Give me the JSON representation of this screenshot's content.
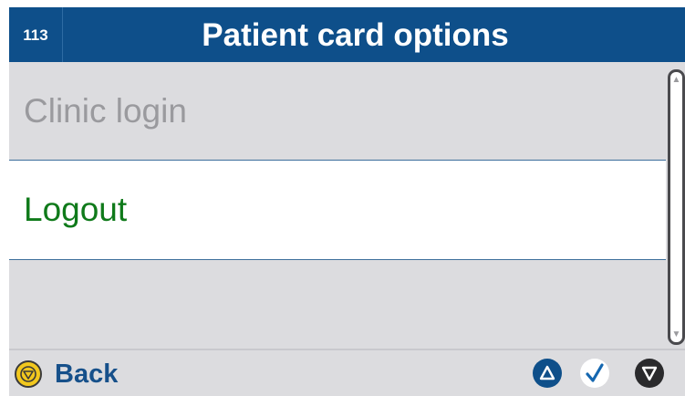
{
  "header": {
    "screen_number": "113",
    "title": "Patient card options"
  },
  "menu": {
    "items": [
      {
        "label": "Clinic login",
        "state": "disabled"
      },
      {
        "label": "Logout",
        "state": "selected"
      }
    ]
  },
  "scrollbar": {
    "up_icon": "triangle-up",
    "down_icon": "triangle-down"
  },
  "footer": {
    "back_label": "Back",
    "back_icon": "stop-icon",
    "nav_icons": [
      "up-icon",
      "confirm-check-icon",
      "down-icon"
    ]
  },
  "colors": {
    "header_bg": "#0e4f8a",
    "selected_text": "#0f7a1a",
    "disabled_text": "#9a9a9e",
    "back_icon": "#f2c81e",
    "back_label": "#16508a"
  }
}
